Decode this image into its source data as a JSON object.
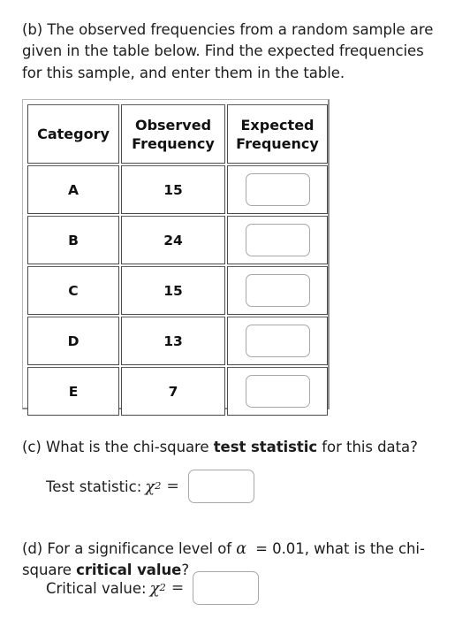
{
  "question_b": {
    "text": "(b) The observed frequencies from a random sample are given in the table below. Find the expected frequencies for this sample, and enter them in the table."
  },
  "table": {
    "headers": {
      "category": "Category",
      "observed_line1": "Observed",
      "observed_line2": "Frequency",
      "expected_line1": "Expected",
      "expected_line2": "Frequency"
    },
    "rows": [
      {
        "category": "A",
        "observed": "15",
        "expected": ""
      },
      {
        "category": "B",
        "observed": "24",
        "expected": ""
      },
      {
        "category": "C",
        "observed": "15",
        "expected": ""
      },
      {
        "category": "D",
        "observed": "13",
        "expected": ""
      },
      {
        "category": "E",
        "observed": "7",
        "expected": ""
      }
    ]
  },
  "question_c": {
    "part_1": "(c) What is the chi-square ",
    "bold": "test statistic",
    "part_2": " for this data?",
    "answer_label": "Test statistic:",
    "symbol": "χ",
    "exponent": "2",
    "equals": "=",
    "value": ""
  },
  "question_d": {
    "part_1": "(d) For a significance level of ",
    "alpha": "α",
    "part_2": " = 0.01, what is the chi-square ",
    "bold": "critical value",
    "part_3": "?",
    "answer_label": "Critical value:",
    "symbol": "χ",
    "exponent": "2",
    "equals": "=",
    "value": ""
  },
  "colors": {
    "text": "#1c1c1c",
    "cell_border": "#4a4a4a",
    "frame_border": "#b9b9b9",
    "input_border": "#a8a8a8",
    "background": "#ffffff"
  }
}
